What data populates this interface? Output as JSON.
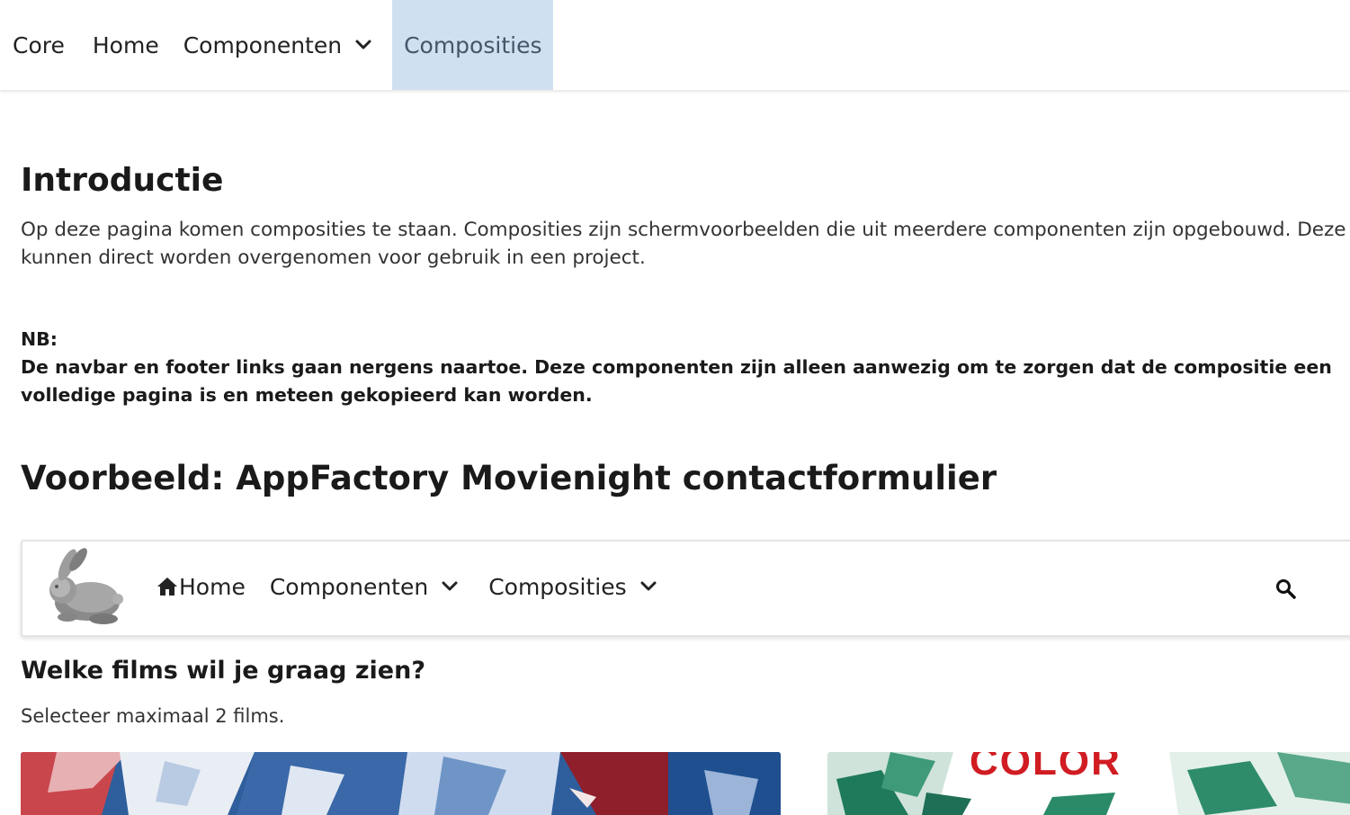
{
  "topnav": {
    "brand": "Core",
    "home": "Home",
    "componenten": "Componenten",
    "composities": "Composities"
  },
  "intro": {
    "title": "Introductie",
    "text": "Op deze pagina komen composities te staan. Composities zijn schermvoorbeelden die uit meerdere componenten zijn opgebouwd. Deze kunnen direct worden overgenomen voor gebruik in een project.",
    "nb_label": "NB:",
    "nb_text": "De navbar en footer links gaan nergens naartoe. Deze componenten zijn alleen aanwezig om te zorgen dat de compositie een volledige pagina is en meteen gekopieerd kan worden."
  },
  "example": {
    "title": "Voorbeeld: AppFactory Movienight contactformulier",
    "navbar": {
      "home": "Home",
      "componenten": "Componenten",
      "composities": "Composities"
    },
    "films_title": "Welke films wil je graag zien?",
    "films_subtitle": "Selecteer maximaal 2 films.",
    "poster_2_text": "COLOR"
  },
  "colors": {
    "active_nav_bg": "#cfe0f1",
    "active_nav_text": "#45566a",
    "poster_title_red": "#d01c22"
  },
  "icons": [
    "chevron-down-icon",
    "home-icon",
    "search-icon",
    "rabbit-logo"
  ]
}
